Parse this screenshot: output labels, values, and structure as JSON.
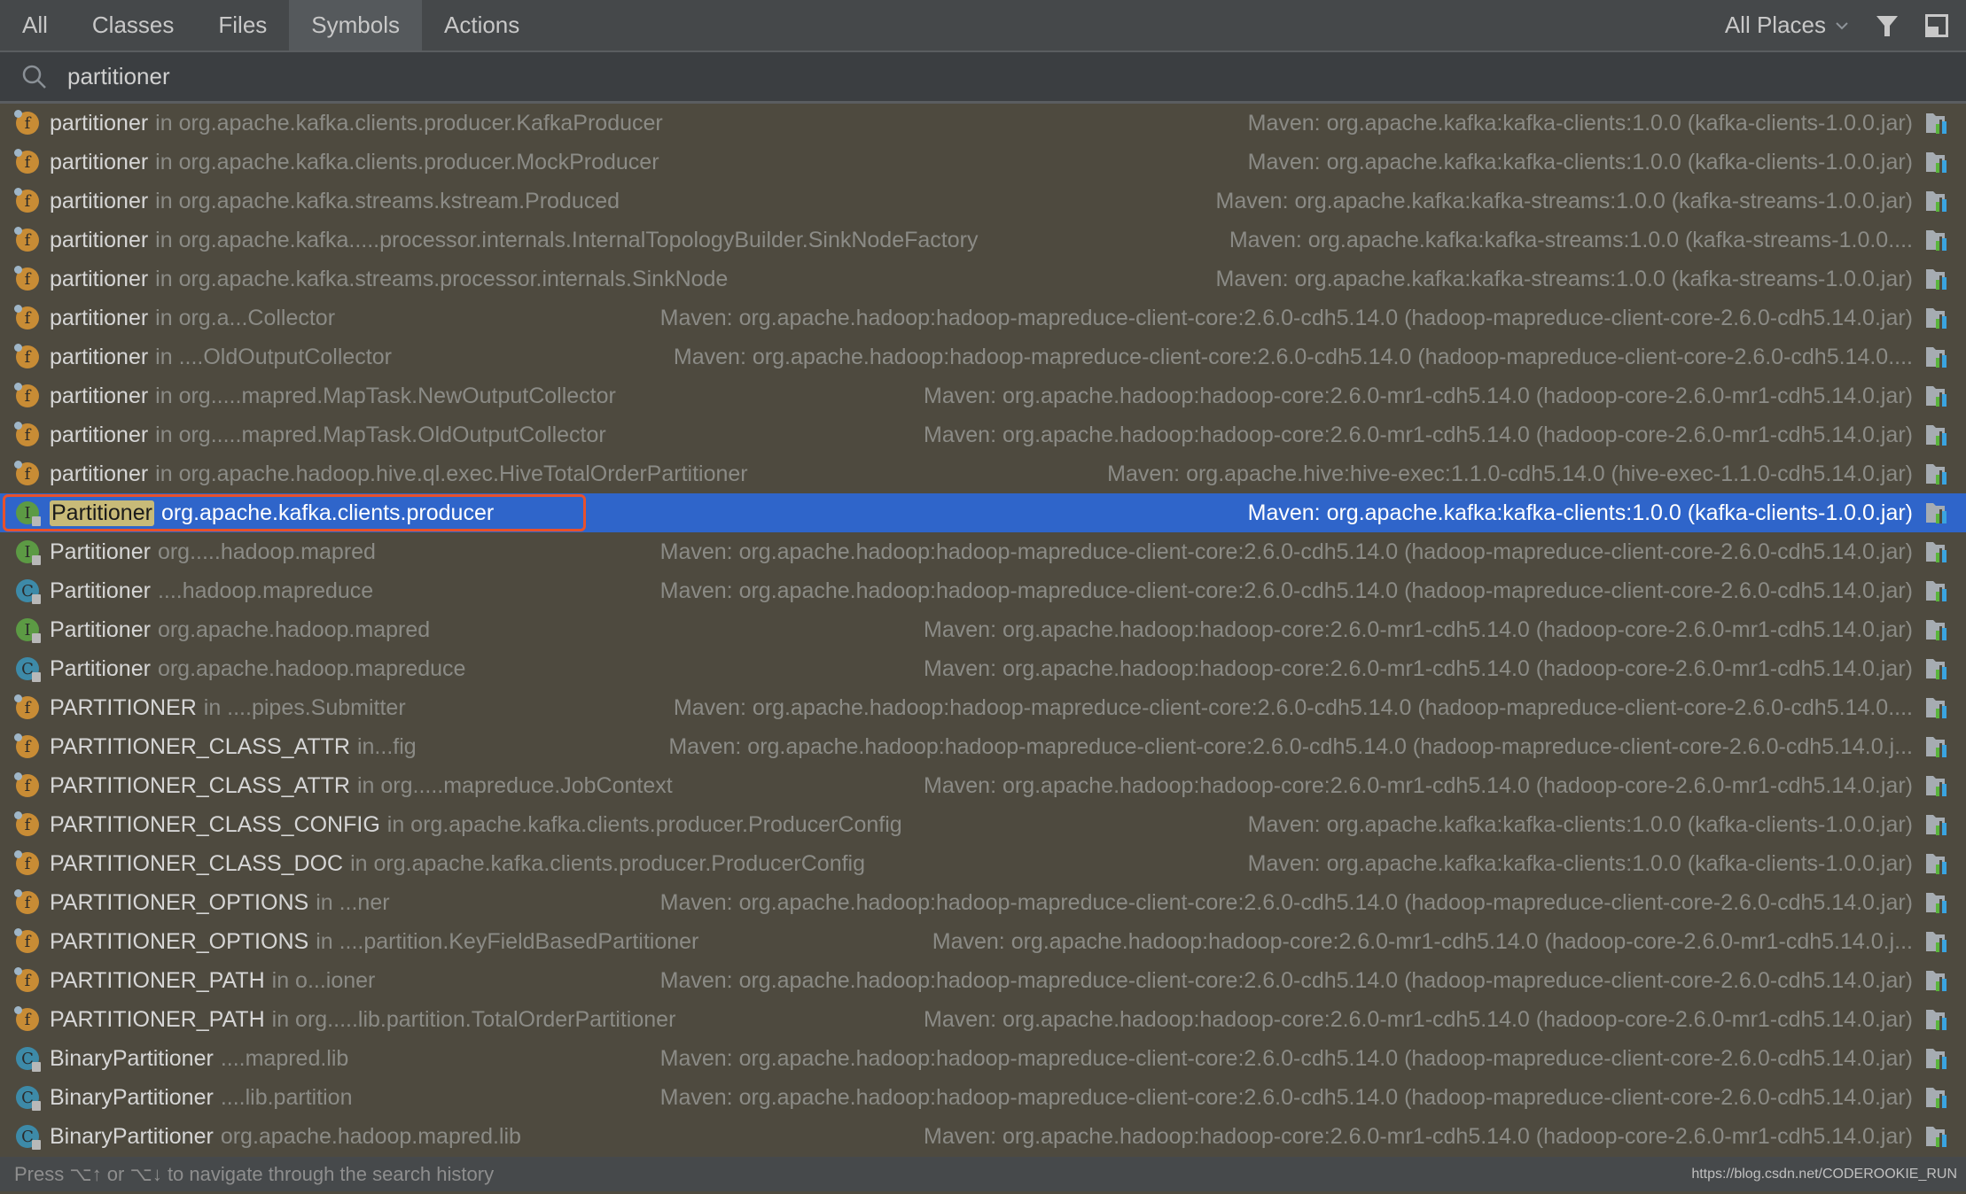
{
  "tabs": [
    {
      "label": "All"
    },
    {
      "label": "Classes"
    },
    {
      "label": "Files"
    },
    {
      "label": "Symbols",
      "selected": true
    },
    {
      "label": "Actions"
    }
  ],
  "toolbar": {
    "scope_label": "All Places",
    "filter_icon": "filter-icon",
    "pin_icon": "window-icon"
  },
  "search": {
    "value": "partitioner",
    "icon": "search-icon"
  },
  "colors": {
    "selection": "#2f65ca",
    "field": "#c88c35",
    "interface": "#5c9a44",
    "class": "#3d8aa8",
    "highlight_match": "#c8ba78",
    "outline": "#e8512c"
  },
  "results": [
    {
      "kind": "field",
      "name": "partitioner",
      "context": "in org.apache.kafka.clients.producer.KafkaProducer",
      "location": "Maven: org.apache.kafka:kafka-clients:1.0.0 (kafka-clients-1.0.0.jar)"
    },
    {
      "kind": "field",
      "name": "partitioner",
      "context": "in org.apache.kafka.clients.producer.MockProducer",
      "location": "Maven: org.apache.kafka:kafka-clients:1.0.0 (kafka-clients-1.0.0.jar)"
    },
    {
      "kind": "field",
      "name": "partitioner",
      "context": "in org.apache.kafka.streams.kstream.Produced",
      "location": "Maven: org.apache.kafka:kafka-streams:1.0.0 (kafka-streams-1.0.0.jar)"
    },
    {
      "kind": "field",
      "name": "partitioner",
      "context": "in org.apache.kafka.....processor.internals.InternalTopologyBuilder.SinkNodeFactory",
      "location": "Maven: org.apache.kafka:kafka-streams:1.0.0 (kafka-streams-1.0.0...."
    },
    {
      "kind": "field",
      "name": "partitioner",
      "context": "in org.apache.kafka.streams.processor.internals.SinkNode",
      "location": "Maven: org.apache.kafka:kafka-streams:1.0.0 (kafka-streams-1.0.0.jar)"
    },
    {
      "kind": "field",
      "name": "partitioner",
      "context": "in org.a...Collector",
      "location": "Maven: org.apache.hadoop:hadoop-mapreduce-client-core:2.6.0-cdh5.14.0 (hadoop-mapreduce-client-core-2.6.0-cdh5.14.0.jar)"
    },
    {
      "kind": "field",
      "name": "partitioner",
      "context": "in ....OldOutputCollector",
      "location": "Maven: org.apache.hadoop:hadoop-mapreduce-client-core:2.6.0-cdh5.14.0 (hadoop-mapreduce-client-core-2.6.0-cdh5.14.0...."
    },
    {
      "kind": "field",
      "name": "partitioner",
      "context": "in org.....mapred.MapTask.NewOutputCollector",
      "location": "Maven: org.apache.hadoop:hadoop-core:2.6.0-mr1-cdh5.14.0 (hadoop-core-2.6.0-mr1-cdh5.14.0.jar)"
    },
    {
      "kind": "field",
      "name": "partitioner",
      "context": "in org.....mapred.MapTask.OldOutputCollector",
      "location": "Maven: org.apache.hadoop:hadoop-core:2.6.0-mr1-cdh5.14.0 (hadoop-core-2.6.0-mr1-cdh5.14.0.jar)"
    },
    {
      "kind": "field",
      "name": "partitioner",
      "context": "in org.apache.hadoop.hive.ql.exec.HiveTotalOrderPartitioner",
      "location": "Maven: org.apache.hive:hive-exec:1.1.0-cdh5.14.0 (hive-exec-1.1.0-cdh5.14.0.jar)"
    },
    {
      "kind": "interface",
      "name": "Partitioner",
      "context": "org.apache.kafka.clients.producer",
      "location": "Maven: org.apache.kafka:kafka-clients:1.0.0 (kafka-clients-1.0.0.jar)",
      "selected": true
    },
    {
      "kind": "interface",
      "name": "Partitioner",
      "context": "org.....hadoop.mapred",
      "location": "Maven: org.apache.hadoop:hadoop-mapreduce-client-core:2.6.0-cdh5.14.0 (hadoop-mapreduce-client-core-2.6.0-cdh5.14.0.jar)"
    },
    {
      "kind": "class",
      "name": "Partitioner",
      "context": "....hadoop.mapreduce",
      "location": "Maven: org.apache.hadoop:hadoop-mapreduce-client-core:2.6.0-cdh5.14.0 (hadoop-mapreduce-client-core-2.6.0-cdh5.14.0.jar)"
    },
    {
      "kind": "interface",
      "name": "Partitioner",
      "context": "org.apache.hadoop.mapred",
      "location": "Maven: org.apache.hadoop:hadoop-core:2.6.0-mr1-cdh5.14.0 (hadoop-core-2.6.0-mr1-cdh5.14.0.jar)"
    },
    {
      "kind": "class",
      "name": "Partitioner",
      "context": "org.apache.hadoop.mapreduce",
      "location": "Maven: org.apache.hadoop:hadoop-core:2.6.0-mr1-cdh5.14.0 (hadoop-core-2.6.0-mr1-cdh5.14.0.jar)"
    },
    {
      "kind": "field",
      "name": "PARTITIONER",
      "context": "in ....pipes.Submitter",
      "location": "Maven: org.apache.hadoop:hadoop-mapreduce-client-core:2.6.0-cdh5.14.0 (hadoop-mapreduce-client-core-2.6.0-cdh5.14.0...."
    },
    {
      "kind": "field",
      "name": "PARTITIONER_CLASS_ATTR",
      "context": "in...fig",
      "location": "Maven: org.apache.hadoop:hadoop-mapreduce-client-core:2.6.0-cdh5.14.0 (hadoop-mapreduce-client-core-2.6.0-cdh5.14.0.j..."
    },
    {
      "kind": "field",
      "name": "PARTITIONER_CLASS_ATTR",
      "context": "in org.....mapreduce.JobContext",
      "location": "Maven: org.apache.hadoop:hadoop-core:2.6.0-mr1-cdh5.14.0 (hadoop-core-2.6.0-mr1-cdh5.14.0.jar)"
    },
    {
      "kind": "field",
      "name": "PARTITIONER_CLASS_CONFIG",
      "context": "in org.apache.kafka.clients.producer.ProducerConfig",
      "location": "Maven: org.apache.kafka:kafka-clients:1.0.0 (kafka-clients-1.0.0.jar)"
    },
    {
      "kind": "field",
      "name": "PARTITIONER_CLASS_DOC",
      "context": "in org.apache.kafka.clients.producer.ProducerConfig",
      "location": "Maven: org.apache.kafka:kafka-clients:1.0.0 (kafka-clients-1.0.0.jar)"
    },
    {
      "kind": "field",
      "name": "PARTITIONER_OPTIONS",
      "context": "in ...ner",
      "location": "Maven: org.apache.hadoop:hadoop-mapreduce-client-core:2.6.0-cdh5.14.0 (hadoop-mapreduce-client-core-2.6.0-cdh5.14.0.jar)"
    },
    {
      "kind": "field",
      "name": "PARTITIONER_OPTIONS",
      "context": "in ....partition.KeyFieldBasedPartitioner",
      "location": "Maven: org.apache.hadoop:hadoop-core:2.6.0-mr1-cdh5.14.0 (hadoop-core-2.6.0-mr1-cdh5.14.0.j..."
    },
    {
      "kind": "field",
      "name": "PARTITIONER_PATH",
      "context": "in o...ioner",
      "location": "Maven: org.apache.hadoop:hadoop-mapreduce-client-core:2.6.0-cdh5.14.0 (hadoop-mapreduce-client-core-2.6.0-cdh5.14.0.jar)"
    },
    {
      "kind": "field",
      "name": "PARTITIONER_PATH",
      "context": "in org.....lib.partition.TotalOrderPartitioner",
      "location": "Maven: org.apache.hadoop:hadoop-core:2.6.0-mr1-cdh5.14.0 (hadoop-core-2.6.0-mr1-cdh5.14.0.jar)"
    },
    {
      "kind": "class",
      "name": "BinaryPartitioner",
      "context": "....mapred.lib",
      "location": "Maven: org.apache.hadoop:hadoop-mapreduce-client-core:2.6.0-cdh5.14.0 (hadoop-mapreduce-client-core-2.6.0-cdh5.14.0.jar)"
    },
    {
      "kind": "class",
      "name": "BinaryPartitioner",
      "context": "....lib.partition",
      "location": "Maven: org.apache.hadoop:hadoop-mapreduce-client-core:2.6.0-cdh5.14.0 (hadoop-mapreduce-client-core-2.6.0-cdh5.14.0.jar)"
    },
    {
      "kind": "class",
      "name": "BinaryPartitioner",
      "context": "org.apache.hadoop.mapred.lib",
      "location": "Maven: org.apache.hadoop:hadoop-core:2.6.0-mr1-cdh5.14.0 (hadoop-core-2.6.0-mr1-cdh5.14.0.jar)"
    }
  ],
  "status": {
    "hint": "Press ⌥↑ or ⌥↓ to navigate through the search history",
    "watermark": "https://blog.csdn.net/CODEROOKIE_RUN"
  }
}
